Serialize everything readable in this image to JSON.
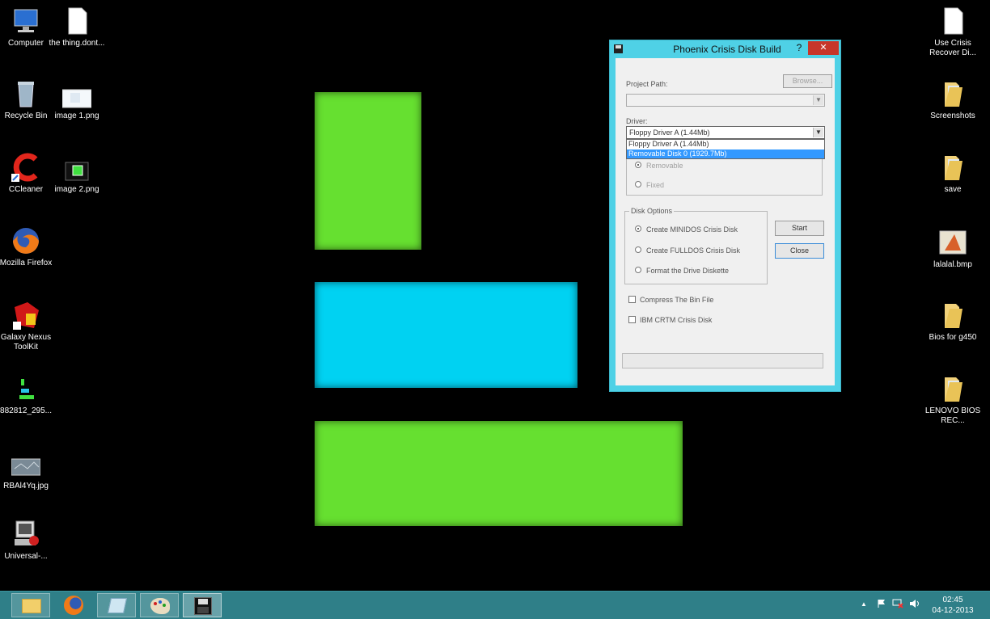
{
  "desktop": {
    "icons_left": [
      {
        "label": "Computer",
        "icon": "computer-icon"
      },
      {
        "label": "the thing.dont...",
        "icon": "document-icon"
      },
      {
        "label": "Recycle Bin",
        "icon": "recycle-bin-icon"
      },
      {
        "label": "image 1.png",
        "icon": "image-file-icon"
      },
      {
        "label": "CCleaner",
        "icon": "ccleaner-icon"
      },
      {
        "label": "image 2.png",
        "icon": "image-file-icon"
      },
      {
        "label": "Mozilla Firefox",
        "icon": "firefox-icon"
      },
      {
        "label": "Galaxy Nexus ToolKit",
        "icon": "toolkit-icon"
      },
      {
        "label": "882812_295...",
        "icon": "chart-file-icon"
      },
      {
        "label": "RBAl4Yq.jpg",
        "icon": "image-file-icon"
      },
      {
        "label": "Universal-...",
        "icon": "universal-installer-icon"
      }
    ],
    "icons_right": [
      {
        "label": "Use Crisis Recover Di...",
        "icon": "document-icon"
      },
      {
        "label": "Screenshots",
        "icon": "folder-icon"
      },
      {
        "label": "save",
        "icon": "folder-icon"
      },
      {
        "label": "lalalal.bmp",
        "icon": "image-file-icon"
      },
      {
        "label": "Bios for g450",
        "icon": "folder-icon"
      },
      {
        "label": "LENOVO BIOS REC...",
        "icon": "folder-icon"
      }
    ],
    "colors": {
      "wall_green": "#66e030",
      "wall_cyan": "#00d2f2"
    }
  },
  "dialog": {
    "title": "Phoenix Crisis Disk Build",
    "help_label": "?",
    "close_label": "✕",
    "project_path_label": "Project Path:",
    "browse_label": "Browse...",
    "driver_label": "Driver:",
    "driver_selected": "Floppy Driver A (1.44Mb)",
    "driver_options": [
      "Floppy Driver A (1.44Mb)",
      "Removable Disk 0 (1929.7Mb)"
    ],
    "media_removable": "Removable",
    "media_fixed": "Fixed",
    "disk_options_legend": "Disk Options",
    "opt_minidos": "Create MINIDOS Crisis Disk",
    "opt_fulldos": "Create FULLDOS Crisis Disk",
    "opt_format": "Format the Drive Diskette",
    "start_label": "Start",
    "close_button_label": "Close",
    "compress_label": "Compress The Bin File",
    "ibm_label": "IBM CRTM Crisis Disk"
  },
  "taskbar": {
    "time": "02:45",
    "date": "04-12-2013",
    "apps": [
      "file-explorer-icon",
      "firefox-icon",
      "notebook-icon",
      "paint-icon",
      "floppy-disk-icon"
    ],
    "tray_icons": [
      "show-hidden-icons-icon",
      "action-center-flag-icon",
      "network-icon",
      "volume-icon"
    ]
  }
}
